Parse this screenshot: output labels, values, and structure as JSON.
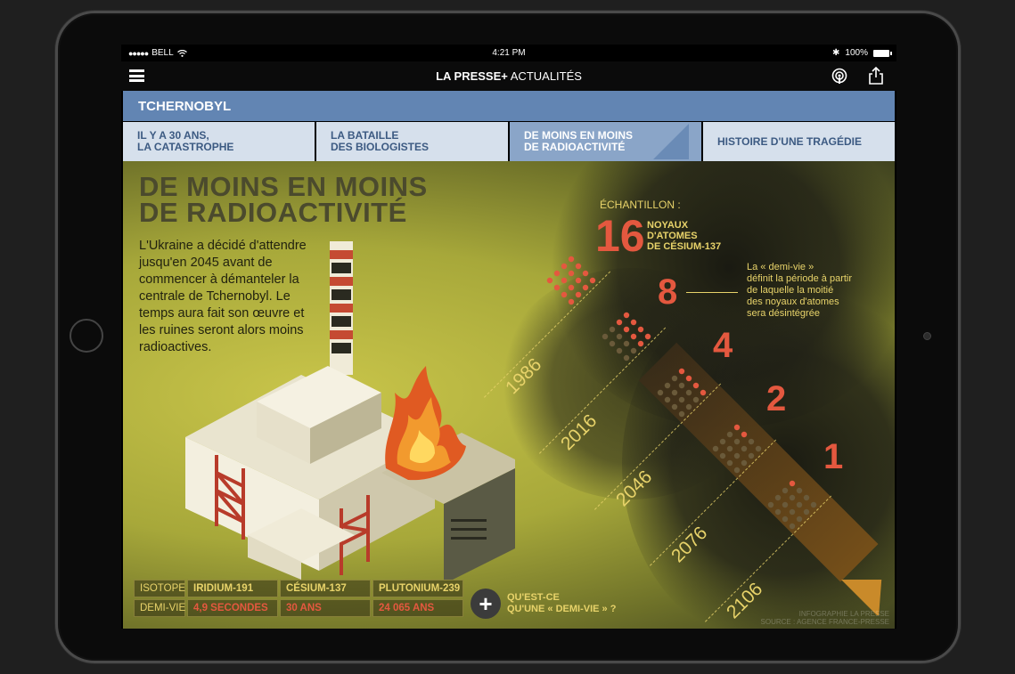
{
  "status_bar": {
    "carrier": "BELL",
    "time": "4:21 PM",
    "battery": "100%"
  },
  "app_header": {
    "title_bold": "LA PRESSE+",
    "title_section": " ACTUALITÉS"
  },
  "section": {
    "title": "TCHERNOBYL"
  },
  "tabs": [
    {
      "line1": "IL Y A 30 ANS,",
      "line2": "LA CATASTROPHE"
    },
    {
      "line1": "LA BATAILLE",
      "line2": "DES BIOLOGISTES"
    },
    {
      "line1": "DE MOINS EN MOINS",
      "line2": "DE RADIOACTIVITÉ"
    },
    {
      "line1": "HISTOIRE D'UNE TRAGÉDIE",
      "line2": ""
    }
  ],
  "infographic": {
    "headline_1": "DE MOINS EN MOINS",
    "headline_2": "DE RADIOACTIVITÉ",
    "intro": "L'Ukraine a décidé d'attendre jusqu'en 2045 avant de commencer à démanteler la centrale de Tchernobyl. Le temps aura fait son œuvre et les ruines seront alors moins radioactives.",
    "sample_label": "ÉCHANTILLON :",
    "sample_unit_1": "NOYAUX",
    "sample_unit_2": "D'ATOMES",
    "sample_unit_3": "DE CÉSIUM-137",
    "note_1": "La « demi-vie »",
    "note_2": "définit la période à partir",
    "note_3": "de laquelle la moitié",
    "note_4": "des noyaux d'atomes",
    "note_5": "sera désintégrée",
    "colors": {
      "accent": "#e4583f",
      "gold": "#e8d36a",
      "tab_active": "#8aa5c8",
      "section": "#6285b3"
    },
    "timeline": [
      {
        "year": "1986",
        "count": "16",
        "count_value": 16
      },
      {
        "year": "2016",
        "count": "8",
        "count_value": 8
      },
      {
        "year": "2046",
        "count": "4",
        "count_value": 4
      },
      {
        "year": "2076",
        "count": "2",
        "count_value": 2
      },
      {
        "year": "2106",
        "count": "1",
        "count_value": 1
      }
    ],
    "table": {
      "row1_head": "ISOTOPE",
      "row2_head": "DEMI-VIE",
      "isotopes": [
        "IRIDIUM-191",
        "CÉSIUM-137",
        "PLUTONIUM-239"
      ],
      "half_lives": [
        "4,9 SECONDES",
        "30 ANS",
        "24 065 ANS"
      ]
    },
    "more_1": "QU'EST-CE",
    "more_2": "QU'UNE « DEMI-VIE » ?",
    "credit_1": "INFOGRAPHIE LA PRESSE",
    "credit_2": "SOURCE : AGENCE FRANCE-PRESSE"
  }
}
